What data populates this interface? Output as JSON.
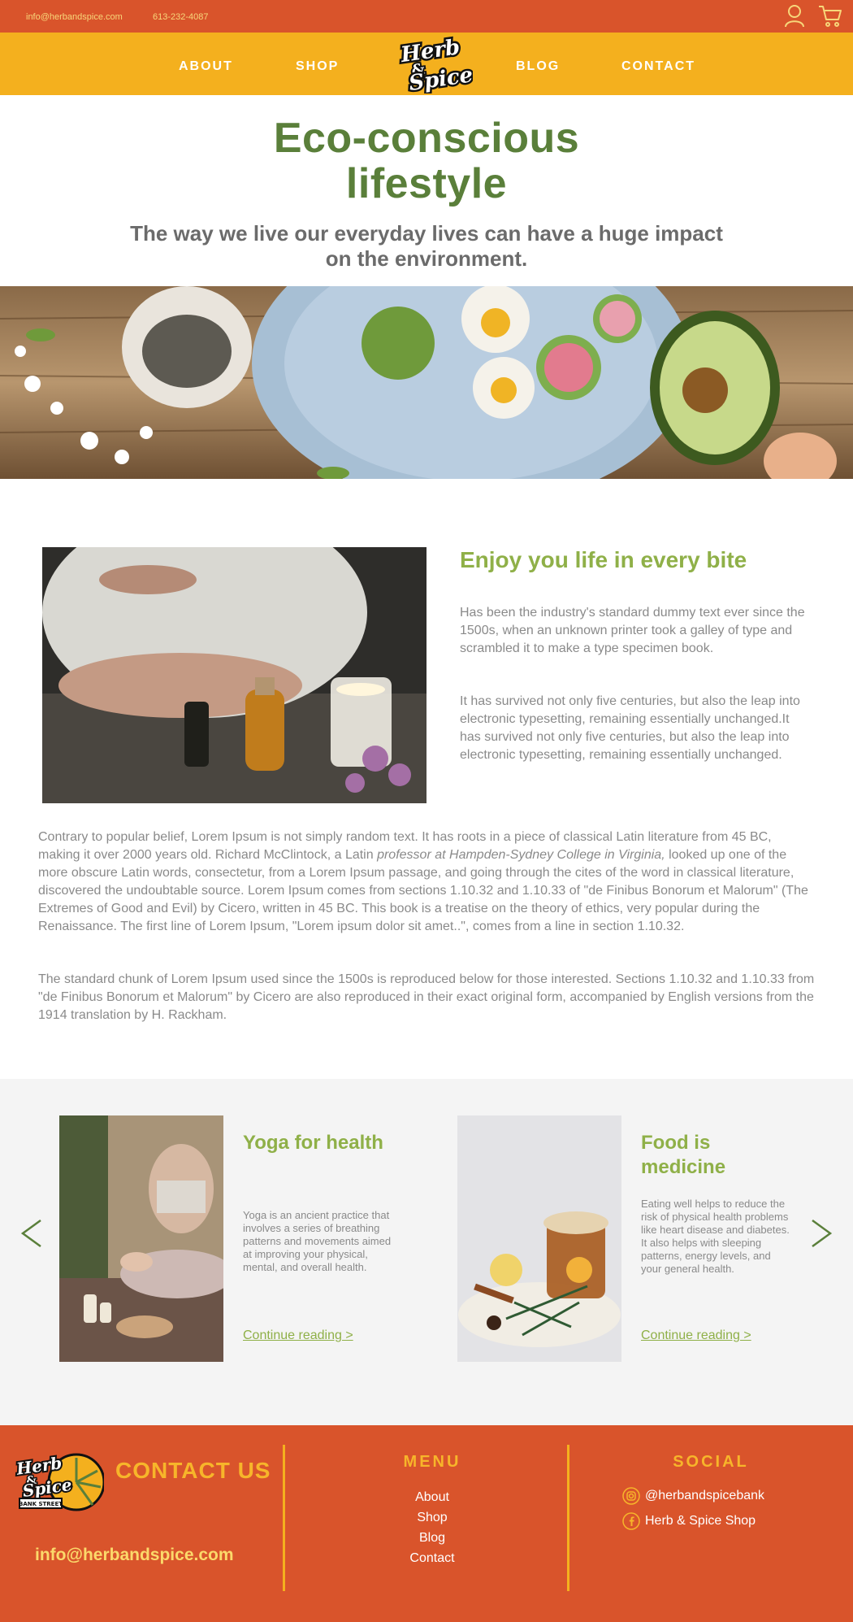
{
  "topbar": {
    "email": "info@herbandspice.com",
    "phone": "613-232-4087"
  },
  "nav": {
    "about": "ABOUT",
    "shop": "SHOP",
    "blog": "BLOG",
    "contact": "CONTACT",
    "logo_line1": "Herb",
    "logo_line2": "&",
    "logo_line3": "Spice"
  },
  "hero": {
    "title_line1": "Eco-conscious",
    "title_line2": "lifestyle",
    "subtitle": "The way we live our everyday lives can have a huge impact on the environment."
  },
  "feature": {
    "title": "Enjoy you life in every bite",
    "p1": "Has been the industry's standard dummy text ever since the 1500s, when an unknown printer took a galley of type and scrambled it to make a type specimen book.",
    "p2": "It has survived not only five centuries, but also the leap into electronic typesetting, remaining essentially unchanged.It has survived not only five centuries, but also the leap into electronic typesetting, remaining essentially unchanged."
  },
  "body": {
    "p1_before": "Contrary to popular belief, Lorem Ipsum is not simply random text. It has roots in a piece of classical Latin literature from 45 BC, making it over 2000 years old. Richard McClintock, a Latin ",
    "p1_italic": "professor at Hampden-Sydney College in Virginia,",
    "p1_after": " looked up one of the more obscure Latin words, consectetur, from a Lorem Ipsum passage, and going through the cites of the word in classical literature, discovered the undoubtable source. Lorem Ipsum comes from sections 1.10.32 and 1.10.33 of \"de Finibus Bonorum et Malorum\" (The Extremes of Good and Evil) by Cicero, written in 45 BC. This book is a treatise on the theory of ethics, very popular during the Renaissance. The first line of Lorem Ipsum, \"Lorem ipsum dolor sit amet..\", comes from a line in section 1.10.32.",
    "p2": "The standard chunk of Lorem Ipsum used since the 1500s is reproduced below for those interested. Sections 1.10.32 and 1.10.33 from \"de Finibus Bonorum et Malorum\" by Cicero are also reproduced in their exact original form, accompanied by English versions from the 1914 translation by H. Rackham."
  },
  "blog": {
    "cards": [
      {
        "title": "Yoga for health",
        "text": "Yoga is an ancient practice that involves a series of breathing patterns and movements aimed at improving your physical, mental, and overall health.",
        "link": "Continue reading >"
      },
      {
        "title": "Food is medicine",
        "text": "Eating well helps to reduce the risk of physical health problems like heart disease and diabetes. It also helps with sleeping patterns, energy levels, and your general health.",
        "link": "Continue reading >"
      }
    ]
  },
  "footer": {
    "contact_title": "CONTACT US",
    "email": "info@herbandspice.com",
    "logo_sub": "BANK STREET",
    "menu_heading": "MENU",
    "menu_items": [
      "About",
      "Shop",
      "Blog",
      "Contact"
    ],
    "social_heading": "SOCIAL",
    "instagram": "@herbandspicebank",
    "facebook": "Herb & Spice Shop"
  },
  "colors": {
    "orange": "#d9542b",
    "yellow": "#f4b01e",
    "green_dark": "#5a7f3a",
    "green_light": "#8fb048"
  },
  "icons": [
    "user-icon",
    "cart-icon",
    "chevron-left-icon",
    "chevron-right-icon",
    "instagram-icon",
    "facebook-icon"
  ]
}
